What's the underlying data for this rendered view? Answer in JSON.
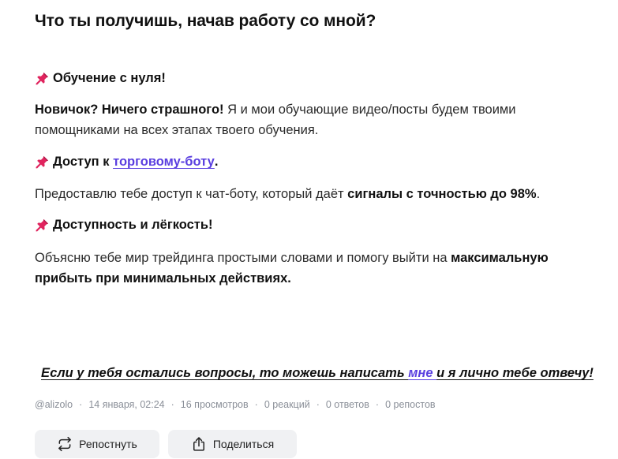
{
  "post": {
    "title": "Что ты получишь, начав работу со мной?",
    "sections": [
      {
        "heading": "Обучение с нуля!",
        "para_bold": "Новичок? Ничего страшного!",
        "para_text": " Я и мои обучающие видео/посты будем твоими помощниками на всех этапах твоего обучения."
      },
      {
        "heading_prefix": "Доступ к ",
        "heading_link": "торговому-боту",
        "heading_suffix": ".",
        "para_text": "Предоставлю тебе доступ к чат-боту, который даёт ",
        "para_bold": "сигналы с точностью до 98%",
        "para_suffix": "."
      },
      {
        "heading": "Доступность и лёгкость!",
        "para_text": "Объясню тебе мир трейдинга простыми словами и помогу выйти на ",
        "para_bold": "максимальную прибыть при минимальных действиях."
      }
    ],
    "cta_prefix": "Если у тебя остались вопросы, то можешь написать ",
    "cta_link": "мне ",
    "cta_suffix": "и я лично тебе отвечу!"
  },
  "meta": {
    "author": "@alizolo",
    "date": "14 января, 02:24",
    "views": "16 просмотров",
    "reactions": "0 реакций",
    "replies": "0 ответов",
    "reposts": "0 репостов"
  },
  "actions": {
    "repost_label": "Репостнуть",
    "share_label": "Поделиться"
  },
  "colors": {
    "link": "#5a3fe0",
    "pin": "#e0245e",
    "meta": "#8a8f98",
    "button_bg": "#f0f1f3"
  },
  "icons": [
    "pushpin-icon",
    "repost-icon",
    "share-icon"
  ]
}
